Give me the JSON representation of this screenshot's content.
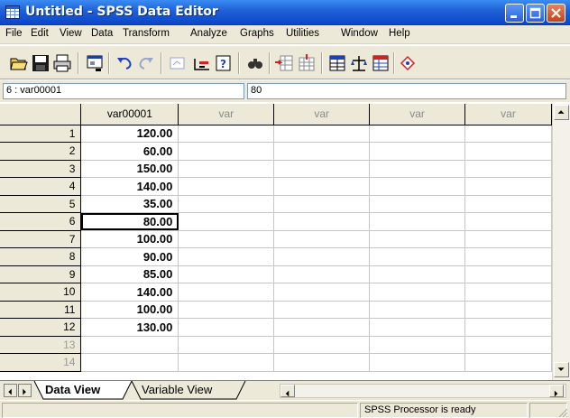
{
  "window": {
    "title": "Untitled - SPSS Data Editor"
  },
  "menu": [
    "File",
    "Edit",
    "View",
    "Data",
    "Transform",
    "Analyze",
    "Graphs",
    "Utilities",
    "Window",
    "Help"
  ],
  "toolbar": {
    "icons": [
      "open-icon",
      "save-icon",
      "print-icon",
      "dialog-recall-icon",
      "undo-icon",
      "redo-icon",
      "goto-chart-icon",
      "goto-case-icon",
      "variables-icon",
      "find-icon",
      "insert-case-icon",
      "insert-variable-icon",
      "split-file-icon",
      "weight-cases-icon",
      "select-cases-icon",
      "value-labels-icon"
    ]
  },
  "editor": {
    "cell_ref": "6 : var00001",
    "cell_value": "80"
  },
  "grid": {
    "columns": [
      "var00001",
      "var",
      "var",
      "var",
      "var"
    ],
    "rows": [
      {
        "num": "1",
        "value": "120.00"
      },
      {
        "num": "2",
        "value": "60.00"
      },
      {
        "num": "3",
        "value": "150.00"
      },
      {
        "num": "4",
        "value": "140.00"
      },
      {
        "num": "5",
        "value": "35.00"
      },
      {
        "num": "6",
        "value": "80.00"
      },
      {
        "num": "7",
        "value": "100.00"
      },
      {
        "num": "8",
        "value": "90.00"
      },
      {
        "num": "9",
        "value": "85.00"
      },
      {
        "num": "10",
        "value": "140.00"
      },
      {
        "num": "11",
        "value": "100.00"
      },
      {
        "num": "12",
        "value": "130.00"
      },
      {
        "num": "13",
        "value": ""
      },
      {
        "num": "14",
        "value": ""
      }
    ],
    "active_row": "6"
  },
  "tabs": {
    "data_view": "Data View",
    "variable_view": "Variable View"
  },
  "status": {
    "processor": "SPSS Processor  is ready"
  }
}
